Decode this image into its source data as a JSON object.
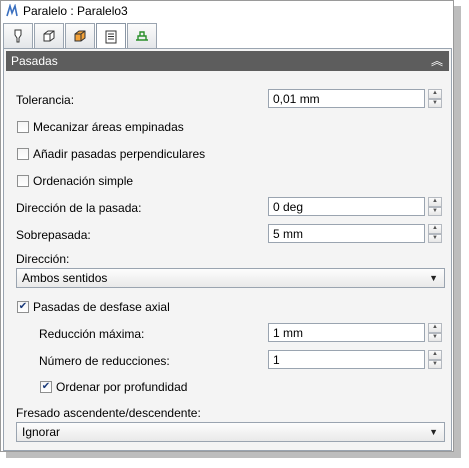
{
  "window": {
    "title": "Paralelo : Paralelo3"
  },
  "tabs": [
    {
      "icon": "tool-icon"
    },
    {
      "icon": "stock-box-icon"
    },
    {
      "icon": "geometry-icon"
    },
    {
      "icon": "passes-icon",
      "active": true
    },
    {
      "icon": "linking-icon"
    }
  ],
  "section": {
    "label": "Pasadas",
    "collapse_glyph": "≈"
  },
  "tolerancia": {
    "label": "Tolerancia:",
    "value": "0,01 mm"
  },
  "mecanizar": {
    "label": "Mecanizar áreas empinadas",
    "checked": false
  },
  "anadir": {
    "label": "Añadir pasadas perpendiculares",
    "checked": false
  },
  "ordenacion": {
    "label": "Ordenación simple",
    "checked": false
  },
  "direccion_pasada": {
    "label": "Dirección de la pasada:",
    "value": "0 deg"
  },
  "sobrepasada": {
    "label": "Sobrepasada:",
    "value": "5 mm"
  },
  "direccion": {
    "label": "Dirección:",
    "selected": "Ambos sentidos"
  },
  "desfase_axial": {
    "label": "Pasadas de desfase axial",
    "checked": true
  },
  "reduccion_maxima": {
    "label": "Reducción máxima:",
    "value": "1 mm"
  },
  "numero_reducciones": {
    "label": "Número de reducciones:",
    "value": "1"
  },
  "ordenar_profundidad": {
    "label": "Ordenar por profundidad",
    "checked": true
  },
  "fresado": {
    "label": "Fresado ascendente/descendente:",
    "selected": "Ignorar"
  },
  "glyphs": {
    "check": "✔",
    "up": "▲",
    "down": "▼",
    "caret": "▼"
  },
  "colors": {
    "header_bg": "#5d5d5d",
    "panel_bg": "#f4f4f4",
    "border": "#9aa4b0"
  }
}
